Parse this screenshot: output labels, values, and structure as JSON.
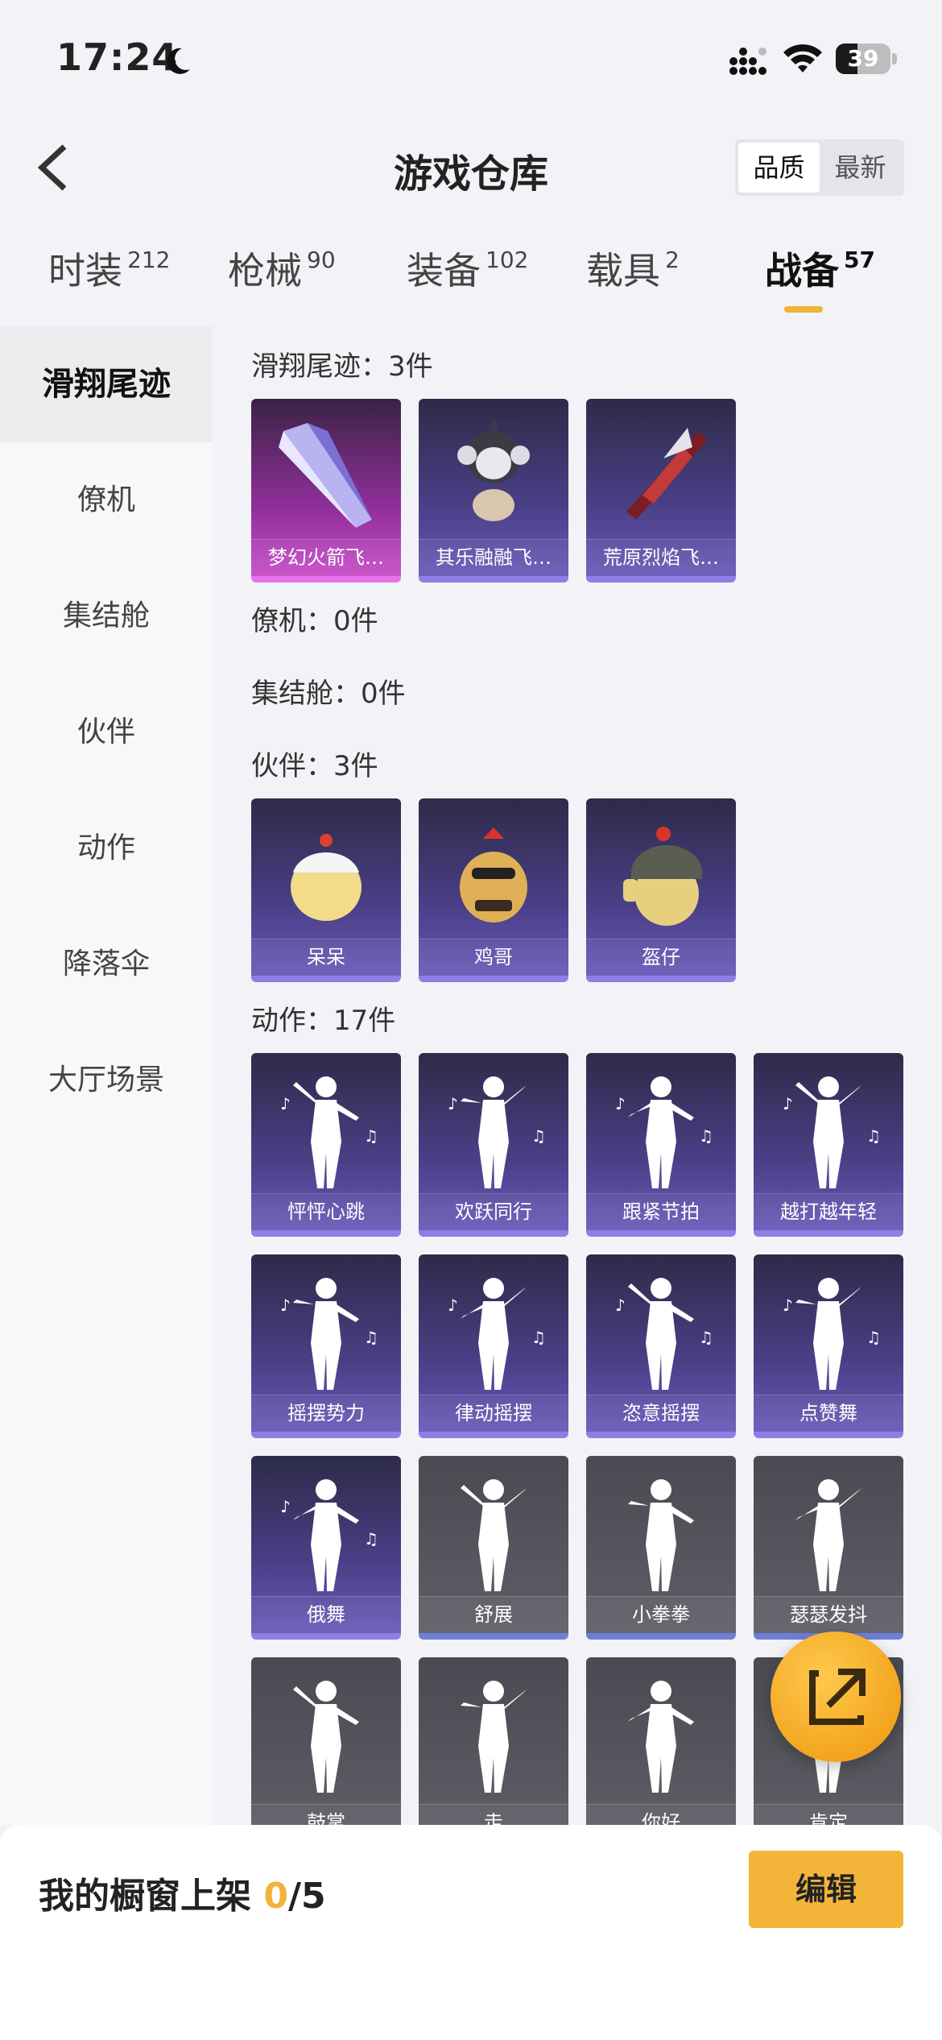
{
  "status_bar": {
    "time": "17:24",
    "battery_level": "39",
    "battery_fraction": 0.39
  },
  "header": {
    "title": "游戏仓库",
    "sort_options": [
      "品质",
      "最新"
    ],
    "active_sort": 0
  },
  "tabs": [
    {
      "label": "时装",
      "count": "212"
    },
    {
      "label": "枪械",
      "count": "90"
    },
    {
      "label": "装备",
      "count": "102"
    },
    {
      "label": "载具",
      "count": "2"
    },
    {
      "label": "战备",
      "count": "57"
    }
  ],
  "active_tab": 4,
  "side_nav": [
    "滑翔尾迹",
    "僚机",
    "集结舱",
    "伙伴",
    "动作",
    "降落伞",
    "大厅场景"
  ],
  "active_side": 0,
  "sections": {
    "glide": {
      "title": "滑翔尾迹：3件",
      "items": [
        "梦幻火箭飞…",
        "其乐融融飞…",
        "荒原烈焰飞…"
      ]
    },
    "wingman": {
      "title": "僚机：0件"
    },
    "pod": {
      "title": "集结舱：0件"
    },
    "companion": {
      "title": "伙伴：3件",
      "items": [
        "呆呆",
        "鸡哥",
        "盔仔"
      ]
    },
    "emote": {
      "title": "动作：17件",
      "items": [
        "怦怦心跳",
        "欢跃同行",
        "跟紧节拍",
        "越打越年轻",
        "摇摆势力",
        "律动摇摆",
        "恣意摇摆",
        "点赞舞",
        "俄舞",
        "舒展",
        "小拳拳",
        "瑟瑟发抖",
        "鼓掌",
        "走",
        "你好",
        "肯定"
      ]
    }
  },
  "bottom_bar": {
    "label": "我的橱窗上架 ",
    "current": "0",
    "total": "/5",
    "edit_label": "编辑"
  },
  "colors": {
    "accent": "#f0b43a",
    "purple_card": "#4a3f86",
    "magenta_card": "#8e2f98",
    "grey_card": "#5e5e66"
  },
  "icons": {
    "back": "chevron-left-icon",
    "share": "share-icon",
    "moon": "moon-icon",
    "wifi": "wifi-icon",
    "signal": "signal-icon"
  }
}
